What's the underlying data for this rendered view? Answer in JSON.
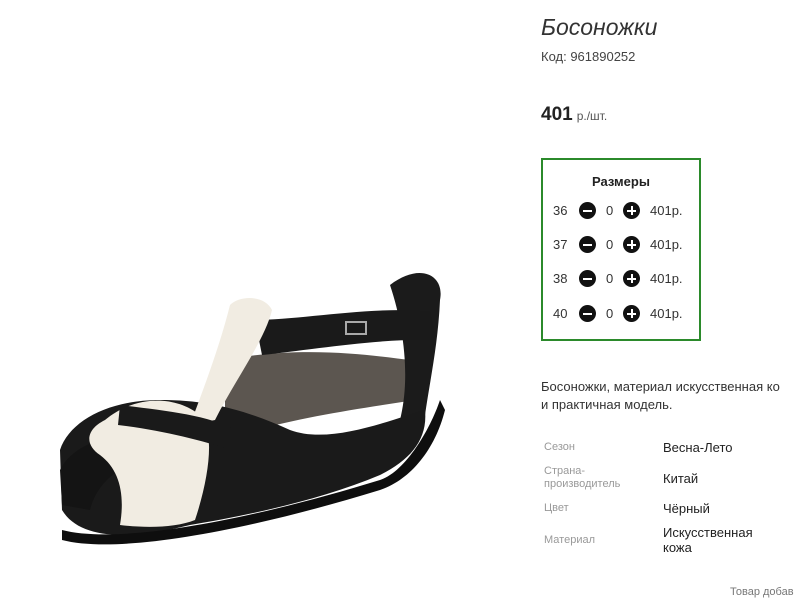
{
  "product": {
    "title": "Босоножки",
    "code": "Код: 961890252",
    "price": "401",
    "price_unit": "р./шт."
  },
  "sizes": {
    "title": "Размеры",
    "rows": [
      {
        "size": "36",
        "qty": "0",
        "price": "401р."
      },
      {
        "size": "37",
        "qty": "0",
        "price": "401р."
      },
      {
        "size": "38",
        "qty": "0",
        "price": "401р."
      },
      {
        "size": "40",
        "qty": "0",
        "price": "401р."
      }
    ]
  },
  "description": {
    "line1": "Босоножки, материал искусственная ко",
    "line2": "и практичная модель."
  },
  "attributes": [
    {
      "key": "Сезон",
      "value": "Весна-Лето"
    },
    {
      "key": "Страна-производитель",
      "key_line1": "Страна-",
      "key_line2": "производитель",
      "value": "Китай"
    },
    {
      "key": "Цвет",
      "value": "Чёрный"
    },
    {
      "key": "Материал",
      "value": "Искусственная кожа",
      "value_line1": "Искусственная",
      "value_line2": "кожа"
    }
  ],
  "footer": {
    "note": "Товар добав"
  },
  "colors": {
    "border_accent": "#2b8a2b",
    "shoe_black": "#1a1a1a",
    "shoe_white": "#f1ece2"
  }
}
